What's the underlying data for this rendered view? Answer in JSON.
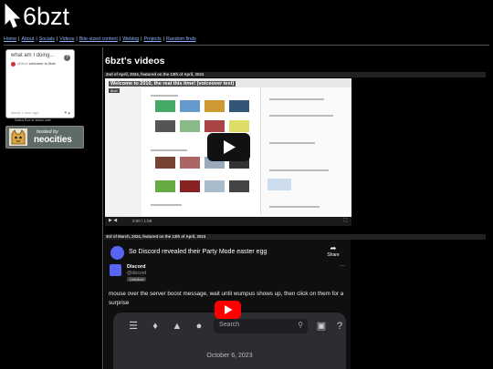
{
  "site": {
    "title": "6bzt"
  },
  "nav": {
    "items": [
      "Home",
      "About",
      "Socials",
      "Videos",
      "Bite-sized content",
      "Weblog",
      "Projects",
      "Random finds"
    ]
  },
  "status_widget": {
    "heading": "what am I doing...",
    "handle": "@6bzt",
    "message": "welcome to 6bzt",
    "time": "about 1 hour ago",
    "arrows": "▾ ▴",
    "credit": "Status Box at status.cafe"
  },
  "badge": {
    "hosted_by": "hosted by",
    "name": "neocities"
  },
  "main": {
    "heading": "6bzt's videos"
  },
  "videos": [
    {
      "date": "2nd of April, 2024, featured on the 13th of April, 2024",
      "title": "Welcome to 2010, the real this time! (voiceover text)",
      "tag": "6bzt",
      "time": "0:00 / 1:58"
    },
    {
      "date": "3rd of March, 2024, featured on the 13th of April, 2024",
      "title": "So Discord revealed their Party Mode easter egg",
      "share_label": "Share",
      "author": "Discord",
      "handle": "@discord",
      "tag": "Unfollow",
      "body": "mouse over the server boost message, wait until wumpus shows up, then click on them for a surprise",
      "search_placeholder": "Search",
      "panel_date": "October 6, 2023"
    }
  ],
  "colors": {
    "link": "#8ab4ff",
    "discord": "#5865f2",
    "youtube": "#ff0000"
  }
}
